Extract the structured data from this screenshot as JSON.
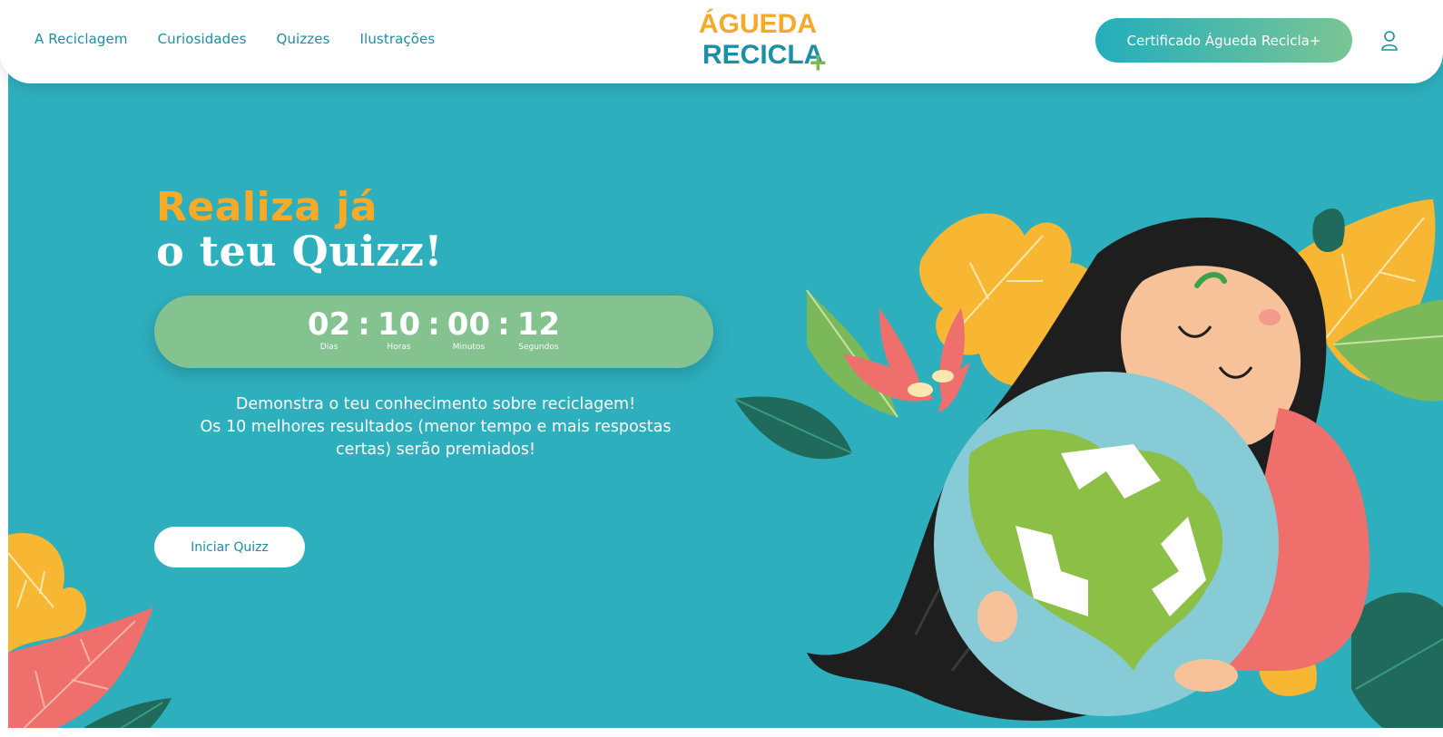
{
  "nav": {
    "items": [
      {
        "label": "A Reciclagem"
      },
      {
        "label": "Curiosidades"
      },
      {
        "label": "Quizzes"
      },
      {
        "label": "Ilustrações"
      }
    ]
  },
  "logo": {
    "line1": "ÁGUEDA",
    "line2": "RECICLA",
    "plus": "+"
  },
  "header": {
    "certificate_label": "Certificado Águeda Recicla+",
    "user_icon": "user-icon"
  },
  "hero": {
    "title_line1": "Realiza já",
    "title_line2": "o teu Quizz!",
    "countdown": [
      {
        "value": "02",
        "label": "Dias"
      },
      {
        "value": "10",
        "label": "Horas"
      },
      {
        "value": "00",
        "label": "Minutos"
      },
      {
        "value": "12",
        "label": "Segundos"
      }
    ],
    "countdown_separator": ":",
    "description_lines": [
      "Demonstra o teu conhecimento sobre reciclagem!",
      "Os 10 melhores resultados (menor tempo e mais respostas",
      "certas) serão premiados!"
    ],
    "start_label": "Iniciar Quizz"
  },
  "colors": {
    "background": "#2eafbd",
    "accent_orange": "#f7a928",
    "countdown_green": "#84c28f",
    "nav_text": "#1a8fa6"
  }
}
